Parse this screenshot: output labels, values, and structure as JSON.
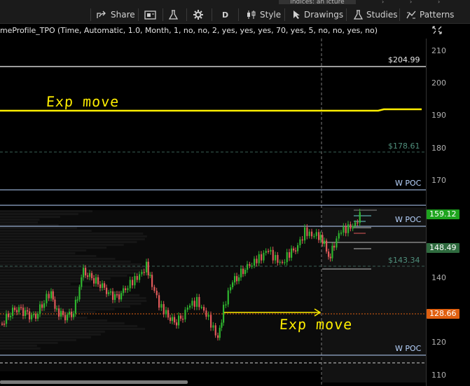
{
  "toolbar": {
    "tab_fragment": "indices: an icture",
    "share_label": "Share",
    "aggregation_label": "D",
    "style_label": "Style",
    "drawings_label": "Drawings",
    "studies_label": "Studies",
    "patterns_label": "Patterns"
  },
  "study": {
    "label": "meProfile_TPO (Time, Automatic, 1.0, Month, 1, no, no, 2, yes, yes, yes, 70, yes, 5, no, no, yes, no)"
  },
  "axis": {
    "ticks": [
      "210",
      "200",
      "190",
      "180",
      "170",
      "160",
      "150",
      "140",
      "130",
      "120",
      "110"
    ]
  },
  "levels": {
    "top_price": "$204.99",
    "mid_price": "$178.61",
    "low_price": "$143.34",
    "wpoc_1": "W POC",
    "wpoc_2": "W POC",
    "wpoc_3": "W POC"
  },
  "badges": {
    "last_price": "159.12",
    "bid_price": "148.49",
    "orange_price": "128.66"
  },
  "annotations": {
    "exp_move_top": "Exp move",
    "exp_move_bottom": "Exp move"
  },
  "colors": {
    "background": "#000000",
    "toolbar": "#1b1b1b",
    "up_candle": "#2fb62f",
    "down_candle": "#e05a5a",
    "annotation": "#ffee00",
    "wpoc_line": "#b8d4ff",
    "last_badge": "#1ea41e",
    "bid_badge": "#2e6a3e",
    "orange_badge": "#e06010"
  }
}
